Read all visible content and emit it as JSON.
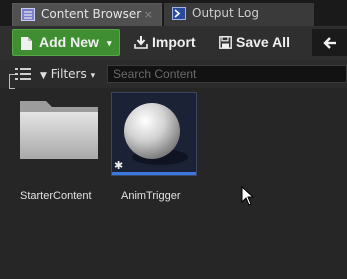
{
  "tabs": [
    {
      "label": "Content Browser",
      "close": "×",
      "active": true
    },
    {
      "label": "Output Log",
      "active": false
    }
  ],
  "toolbar": {
    "add_new_label": "Add New",
    "add_new_caret": "▾",
    "import_label": "Import",
    "save_all_label": "Save All",
    "back_arrow": "🡨"
  },
  "filter_bar": {
    "filters_label": "Filters",
    "filters_caret": "▾",
    "search_placeholder": "Search Content"
  },
  "assets": [
    {
      "name": "StarterContent",
      "type": "folder",
      "icon": "folder-icon"
    },
    {
      "name": "AnimTrigger",
      "type": "blueprint",
      "icon": "sphere-thumbnail",
      "badge": "✱"
    }
  ],
  "colors": {
    "accent_green": "#3f8f32",
    "selection_blue": "#3c78e0",
    "background": "#262626"
  }
}
